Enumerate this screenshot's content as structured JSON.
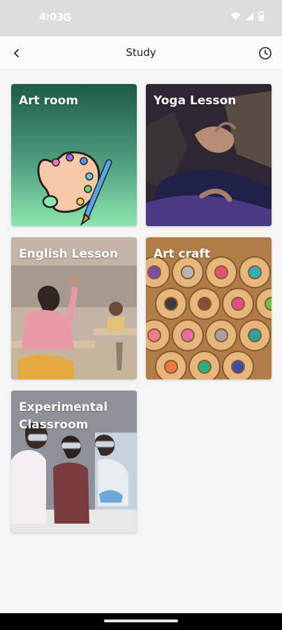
{
  "status_bar": {
    "time": "4:03",
    "g_label": "G"
  },
  "app_bar": {
    "title": "Study"
  },
  "cards": [
    {
      "title": "Art room"
    },
    {
      "title": "Yoga Lesson"
    },
    {
      "title": "English Lesson"
    },
    {
      "title": "Art craft"
    },
    {
      "title": "Experimental Classroom"
    }
  ],
  "colors": {
    "status_bar_bg": "#dcdcdc",
    "app_bar_bg": "#fafafa",
    "page_bg": "#f5f5f5",
    "card_title": "#ffffff"
  },
  "icons": {
    "back": "chevron-left-icon",
    "history": "clock-icon",
    "wifi": "wifi-icon",
    "signal": "signal-icon",
    "battery": "battery-icon"
  }
}
